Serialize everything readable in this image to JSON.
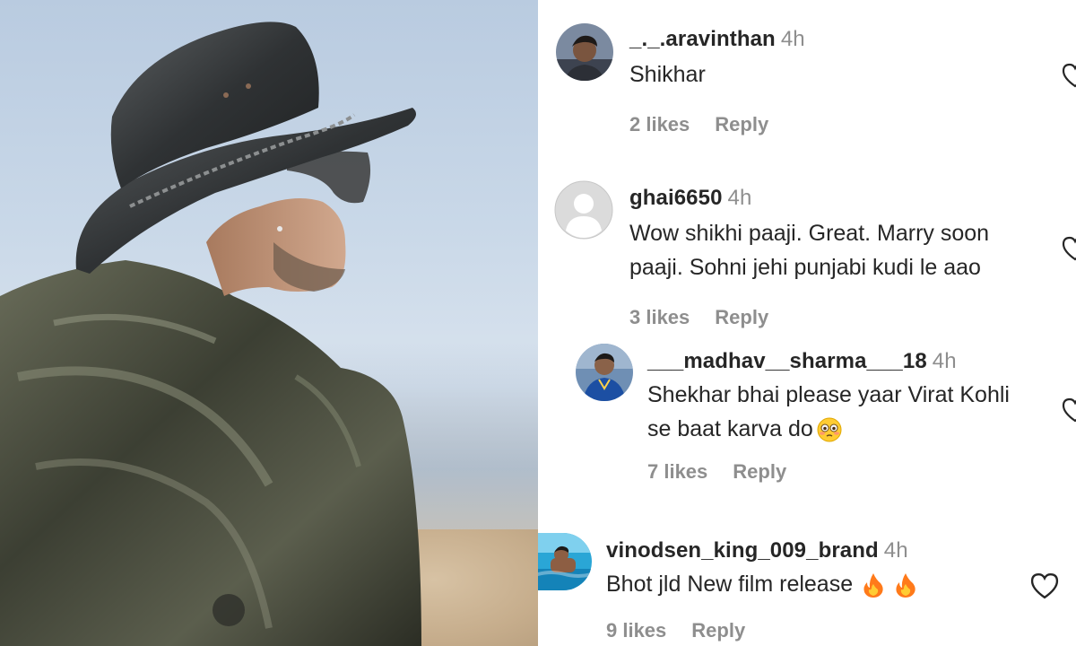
{
  "comments": [
    {
      "username": "_._.aravinthan",
      "time": "4h",
      "text_lines": [
        "Shikhar"
      ],
      "likes": "2 likes",
      "reply_label": "Reply",
      "avatar_icon": "profile-photo-avatar"
    },
    {
      "username": "ghai6650",
      "time": "4h",
      "text_lines": [
        "Wow shikhi paaji. Great. Marry soon",
        "paaji. Sohni jehi punjabi kudi le aao"
      ],
      "likes": "3 likes",
      "reply_label": "Reply",
      "avatar_icon": "default-avatar"
    },
    {
      "username": "___madhav__sharma___18",
      "time": "4h",
      "text_lines": [
        "Shekhar bhai please yaar Virat Kohli",
        "se baat karva do"
      ],
      "emoji_icon": "flushed-face-emoji",
      "likes": "7 likes",
      "reply_label": "Reply",
      "avatar_icon": "cricketer-photo-avatar",
      "is_reply": true
    },
    {
      "username": "vinodsen_king_009_brand",
      "time": "4h",
      "text_lines": [
        "Bhot jld New film release"
      ],
      "emoji_icon": "fire-emoji",
      "likes": "9 likes",
      "reply_label": "Reply",
      "avatar_icon": "pool-photo-avatar"
    }
  ],
  "colors": {
    "text": "#262626",
    "secondary": "#8e8e8e",
    "fire": "#ff7a1a"
  },
  "icons": {
    "like": "heart-outline-icon"
  }
}
